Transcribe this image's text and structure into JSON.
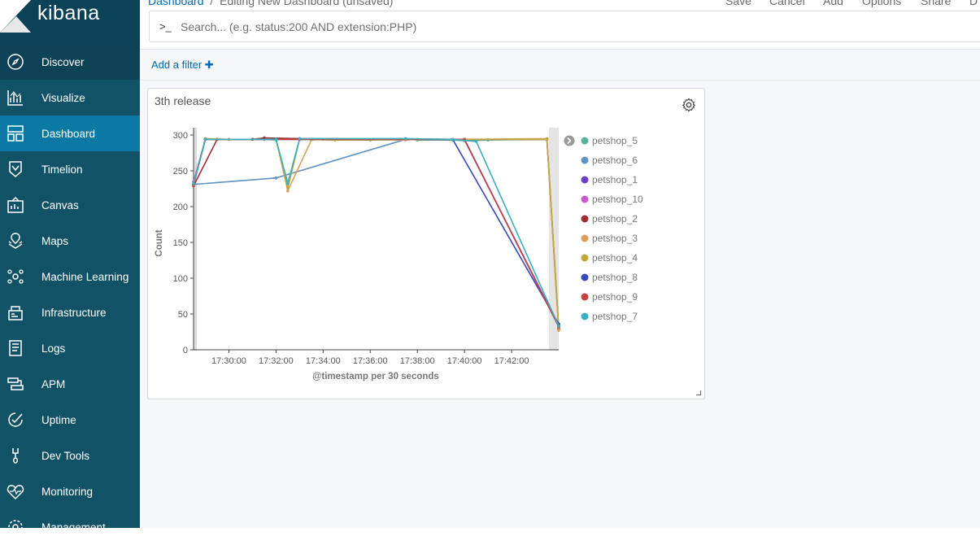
{
  "app": {
    "brand": "kibana"
  },
  "sidebar": {
    "items": [
      {
        "label": "Discover",
        "icon": "compass-icon"
      },
      {
        "label": "Visualize",
        "icon": "visualize-icon"
      },
      {
        "label": "Dashboard",
        "icon": "dashboard-icon"
      },
      {
        "label": "Timelion",
        "icon": "timelion-icon"
      },
      {
        "label": "Canvas",
        "icon": "canvas-icon"
      },
      {
        "label": "Maps",
        "icon": "maps-icon"
      },
      {
        "label": "Machine Learning",
        "icon": "machine-learning-icon"
      },
      {
        "label": "Infrastructure",
        "icon": "infrastructure-icon"
      },
      {
        "label": "Logs",
        "icon": "logs-icon"
      },
      {
        "label": "APM",
        "icon": "apm-icon"
      },
      {
        "label": "Uptime",
        "icon": "uptime-icon"
      },
      {
        "label": "Dev Tools",
        "icon": "wrench-icon"
      },
      {
        "label": "Monitoring",
        "icon": "monitoring-icon"
      },
      {
        "label": "Management",
        "icon": "gear-icon"
      }
    ],
    "active": "Dashboard"
  },
  "header": {
    "breadcrumb_root": "Dashboard",
    "breadcrumb_sep": "/",
    "breadcrumb_current": "Editing New Dashboard (unsaved)",
    "menu": [
      "Save",
      "Cancel",
      "Add",
      "Options",
      "Share",
      "D"
    ]
  },
  "search": {
    "prompt": ">_",
    "placeholder": "Search... (e.g. status:200 AND extension:PHP)"
  },
  "filter": {
    "add_label": "Add a filter",
    "add_icon": "plus-icon"
  },
  "panel": {
    "title": "3th release"
  },
  "colors": {
    "sidebar": "#115267",
    "active": "#0a7aa4",
    "link": "#006bb4"
  },
  "chart_data": {
    "type": "line",
    "title": "",
    "xlabel": "@timestamp per 30 seconds",
    "ylabel": "Count",
    "ylim": [
      0,
      300
    ],
    "yticks": [
      0,
      50,
      100,
      150,
      200,
      250,
      300
    ],
    "xticks": [
      "17:30:00",
      "17:32:00",
      "17:34:00",
      "17:36:00",
      "17:38:00",
      "17:40:00",
      "17:42:00"
    ],
    "xrange": [
      "17:28:30",
      "17:44:00"
    ],
    "legend_position": "right",
    "series": [
      {
        "name": "petshop_5",
        "color": "#54b399",
        "points": [
          [
            "17:28:30",
            232
          ],
          [
            "17:29:00",
            294
          ],
          [
            "17:31:30",
            294
          ],
          [
            "17:32:00",
            293
          ],
          [
            "17:32:30",
            233
          ],
          [
            "17:33:00",
            294
          ],
          [
            "17:37:30",
            295
          ],
          [
            "17:38:00",
            293
          ],
          [
            "17:39:30",
            293
          ],
          [
            "17:40:00",
            292
          ],
          [
            "17:41:00",
            293
          ],
          [
            "17:43:30",
            294
          ],
          [
            "17:44:00",
            30
          ]
        ]
      },
      {
        "name": "petshop_6",
        "color": "#6092c0",
        "points": [
          [
            "17:28:30",
            231
          ],
          [
            "17:32:00",
            240
          ],
          [
            "17:37:30",
            294
          ],
          [
            "17:40:00",
            293
          ],
          [
            "17:44:00",
            34
          ]
        ]
      },
      {
        "name": "petshop_1",
        "color": "#6c3fc7",
        "points": [
          [
            "17:28:30",
            231
          ],
          [
            "17:29:00",
            294
          ],
          [
            "17:33:00",
            294
          ],
          [
            "17:40:00",
            294
          ],
          [
            "17:44:00",
            33
          ]
        ]
      },
      {
        "name": "petshop_10",
        "color": "#c85ac8",
        "points": [
          [
            "17:28:30",
            235
          ],
          [
            "17:29:00",
            294
          ],
          [
            "17:33:00",
            294
          ],
          [
            "17:40:00",
            294
          ],
          [
            "17:43:30",
            294
          ],
          [
            "17:44:00",
            30
          ]
        ]
      },
      {
        "name": "petshop_2",
        "color": "#9c2f32",
        "points": [
          [
            "17:28:30",
            229
          ],
          [
            "17:29:30",
            294
          ],
          [
            "17:31:00",
            294
          ],
          [
            "17:31:30",
            296
          ],
          [
            "17:33:00",
            295
          ],
          [
            "17:40:00",
            294
          ],
          [
            "17:43:30",
            294
          ],
          [
            "17:44:00",
            29
          ]
        ]
      },
      {
        "name": "petshop_3",
        "color": "#d8a05b",
        "points": [
          [
            "17:28:30",
            232
          ],
          [
            "17:29:00",
            294
          ],
          [
            "17:32:00",
            294
          ],
          [
            "17:32:30",
            222
          ],
          [
            "17:33:30",
            293
          ],
          [
            "17:34:00",
            294
          ],
          [
            "17:37:30",
            293
          ],
          [
            "17:38:00",
            294
          ],
          [
            "17:40:00",
            294
          ],
          [
            "17:43:30",
            295
          ],
          [
            "17:44:00",
            27
          ]
        ]
      },
      {
        "name": "petshop_4",
        "color": "#c0a83b",
        "points": [
          [
            "17:28:30",
            230
          ],
          [
            "17:29:00",
            295
          ],
          [
            "17:30:00",
            294
          ],
          [
            "17:32:00",
            294
          ],
          [
            "17:32:30",
            226
          ],
          [
            "17:33:00",
            294
          ],
          [
            "17:34:30",
            293
          ],
          [
            "17:36:00",
            293
          ],
          [
            "17:37:30",
            294
          ],
          [
            "17:40:00",
            294
          ],
          [
            "17:43:30",
            294
          ],
          [
            "17:44:00",
            31
          ]
        ]
      },
      {
        "name": "petshop_8",
        "color": "#3649b8",
        "points": [
          [
            "17:28:30",
            231
          ],
          [
            "17:29:00",
            294
          ],
          [
            "17:33:00",
            294
          ],
          [
            "17:39:30",
            294
          ],
          [
            "17:44:00",
            36
          ]
        ]
      },
      {
        "name": "petshop_9",
        "color": "#c94040",
        "points": [
          [
            "17:28:30",
            231
          ],
          [
            "17:29:00",
            294
          ],
          [
            "17:33:00",
            294
          ],
          [
            "17:40:00",
            294
          ],
          [
            "17:44:00",
            32
          ]
        ]
      },
      {
        "name": "petshop_7",
        "color": "#3aafc0",
        "points": [
          [
            "17:28:30",
            232
          ],
          [
            "17:29:00",
            294
          ],
          [
            "17:32:00",
            294
          ],
          [
            "17:32:30",
            232
          ],
          [
            "17:33:00",
            295
          ],
          [
            "17:37:30",
            295
          ],
          [
            "17:39:30",
            294
          ],
          [
            "17:40:30",
            291
          ],
          [
            "17:44:00",
            33
          ]
        ]
      }
    ]
  }
}
